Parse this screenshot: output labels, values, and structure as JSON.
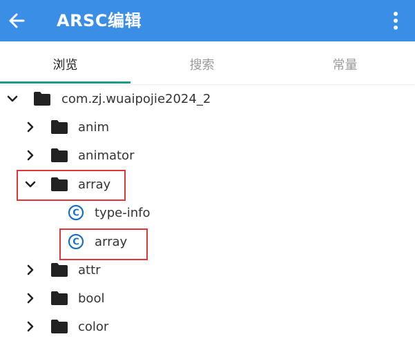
{
  "appbar": {
    "title": "ARSC编辑",
    "back_icon": "arrow-left-icon",
    "more_icon": "more-vertical-icon",
    "color": "#3a8ee6"
  },
  "tabs": [
    {
      "label": "浏览",
      "active": true
    },
    {
      "label": "搜索",
      "active": false
    },
    {
      "label": "常量",
      "active": false
    }
  ],
  "tree": [
    {
      "label": "com.zj.wuaipojie2024_2",
      "type": "folder",
      "expanded": true,
      "depth": 0
    },
    {
      "label": "anim",
      "type": "folder",
      "expanded": false,
      "depth": 1
    },
    {
      "label": "animator",
      "type": "folder",
      "expanded": false,
      "depth": 1
    },
    {
      "label": "array",
      "type": "folder",
      "expanded": true,
      "depth": 1
    },
    {
      "label": "type-info",
      "type": "class",
      "depth": 2
    },
    {
      "label": "array",
      "type": "class",
      "depth": 2
    },
    {
      "label": "attr",
      "type": "folder",
      "expanded": false,
      "depth": 1
    },
    {
      "label": "bool",
      "type": "folder",
      "expanded": false,
      "depth": 1
    },
    {
      "label": "color",
      "type": "folder",
      "expanded": false,
      "depth": 1
    }
  ],
  "highlight_color": "#e0363a"
}
